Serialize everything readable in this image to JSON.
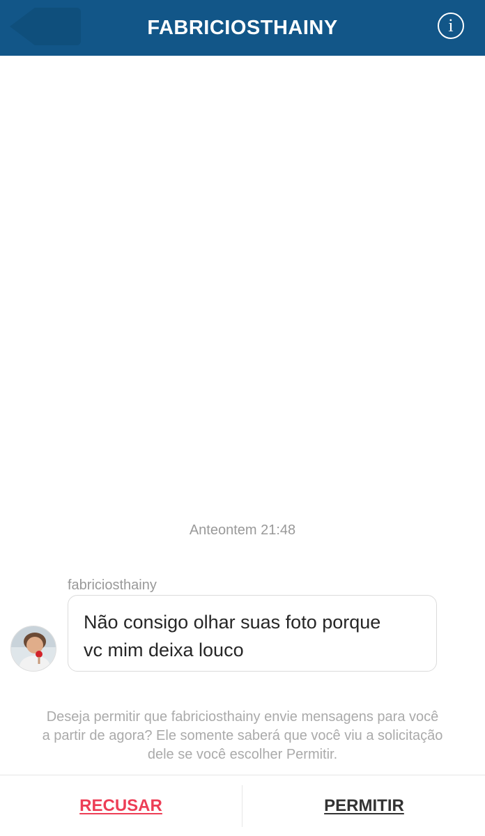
{
  "header": {
    "title": "FABRICIOSTHAINY",
    "info_icon_glyph": "i",
    "background_color": "#125688"
  },
  "conversation": {
    "timestamp": "Anteontem 21:48",
    "sender_username": "fabriciosthainy",
    "message_line1": "Não consigo olhar suas foto porque",
    "message_line2": "vc mim deixa louco"
  },
  "request": {
    "notice_line1": "Deseja permitir que fabriciosthainy envie mensagens para você",
    "notice_line2": "a partir de agora? Ele somente saberá que você viu a solicitação",
    "notice_line3": "dele se você escolher Permitir."
  },
  "actions": {
    "decline_label": "RECUSAR",
    "allow_label": "PERMITIR",
    "decline_color": "#ed3e56"
  },
  "icons": {
    "back": "back-arrow-icon",
    "info": "info-icon",
    "avatar": "profile-avatar"
  }
}
